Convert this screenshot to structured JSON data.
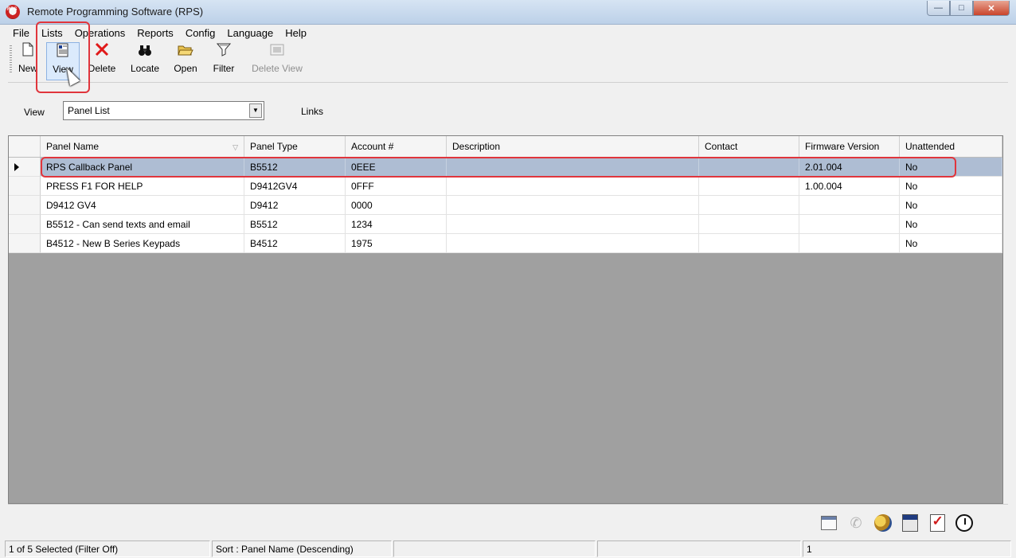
{
  "window": {
    "title": "Remote Programming Software (RPS)",
    "app_icon_text": "RPS"
  },
  "menu": [
    "File",
    "Lists",
    "Operations",
    "Reports",
    "Config",
    "Language",
    "Help"
  ],
  "toolbar": {
    "buttons": [
      {
        "label": "New",
        "icon": "new-document-icon"
      },
      {
        "label": "View",
        "icon": "view-document-icon"
      },
      {
        "label": "Delete",
        "icon": "delete-x-icon"
      },
      {
        "label": "Locate",
        "icon": "binoculars-icon"
      },
      {
        "label": "Open",
        "icon": "open-folder-icon"
      },
      {
        "label": "Filter",
        "icon": "filter-funnel-icon"
      },
      {
        "label": "Delete View",
        "icon": "delete-view-icon",
        "disabled": true
      }
    ]
  },
  "view_row": {
    "label": "View",
    "selected": "Panel List",
    "links_label": "Links"
  },
  "grid": {
    "columns": [
      "Panel Name",
      "Panel Type",
      "Account #",
      "Description",
      "Contact",
      "Firmware Version",
      "Unattended"
    ],
    "rows": [
      [
        "RPS Callback Panel",
        "B5512",
        "0EEE",
        "",
        "",
        "2.01.004",
        "No"
      ],
      [
        "PRESS F1 FOR HELP",
        "D9412GV4",
        "0FFF",
        "",
        "",
        "1.00.004",
        "No"
      ],
      [
        "D9412 GV4",
        "D9412",
        "0000",
        "",
        "",
        "",
        "No"
      ],
      [
        "B5512 - Can send texts and email",
        "B5512",
        "1234",
        "",
        "",
        "",
        "No"
      ],
      [
        "B4512 - New B Series Keypads",
        "B4512",
        "1975",
        "",
        "",
        "",
        "No"
      ]
    ],
    "selected_row": 0
  },
  "quick_icons": [
    "calendar-icon",
    "phone-icon",
    "users-icon",
    "report-icon",
    "checklist-icon",
    "clock-icon"
  ],
  "status": {
    "selection": "1 of 5 Selected (Filter Off)",
    "sort": "Sort : Panel Name (Descending)",
    "panel3": "",
    "panel4": "",
    "count": "1"
  },
  "colors": {
    "selected_row": "#aebdd3",
    "highlight": "#e0353c",
    "grid_background": "#a0a0a0"
  }
}
